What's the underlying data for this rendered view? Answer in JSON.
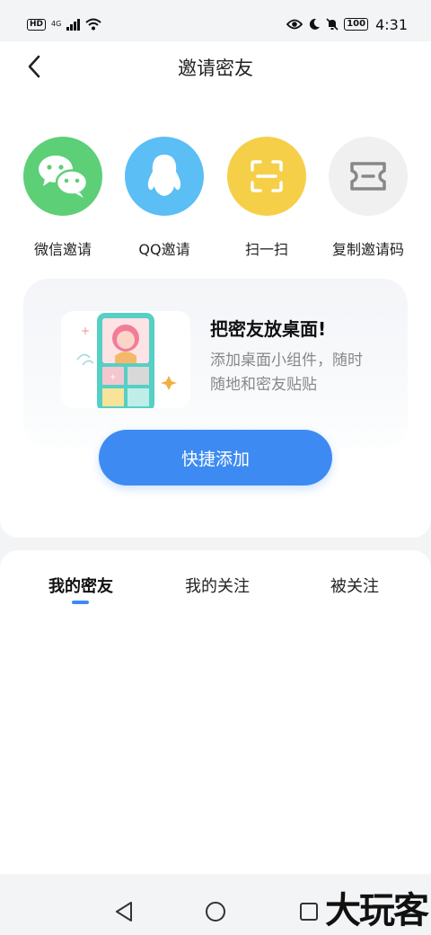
{
  "status_bar": {
    "hd": "HD",
    "network": "4G",
    "battery": "100",
    "time": "4:31"
  },
  "header": {
    "title": "邀请密友",
    "back_icon": "chevron-left-icon"
  },
  "share_options": [
    {
      "label": "微信邀请",
      "icon": "wechat-icon",
      "color": "#5ccf77"
    },
    {
      "label": "QQ邀请",
      "icon": "qq-icon",
      "color": "#5bbef5"
    },
    {
      "label": "扫一扫",
      "icon": "scan-icon",
      "color": "#f5cf48"
    },
    {
      "label": "复制邀请码",
      "icon": "ticket-icon",
      "color": "#f0f0f0"
    }
  ],
  "widget_promo": {
    "title": "把密友放桌面!",
    "description": "添加桌面小组件，随时随地和密友贴贴",
    "button_label": "快捷添加",
    "accent": "#3d8bf2"
  },
  "tabs": [
    {
      "label": "我的密友",
      "active": true
    },
    {
      "label": "我的关注",
      "active": false
    },
    {
      "label": "被关注",
      "active": false
    }
  ],
  "watermark": "大玩客"
}
